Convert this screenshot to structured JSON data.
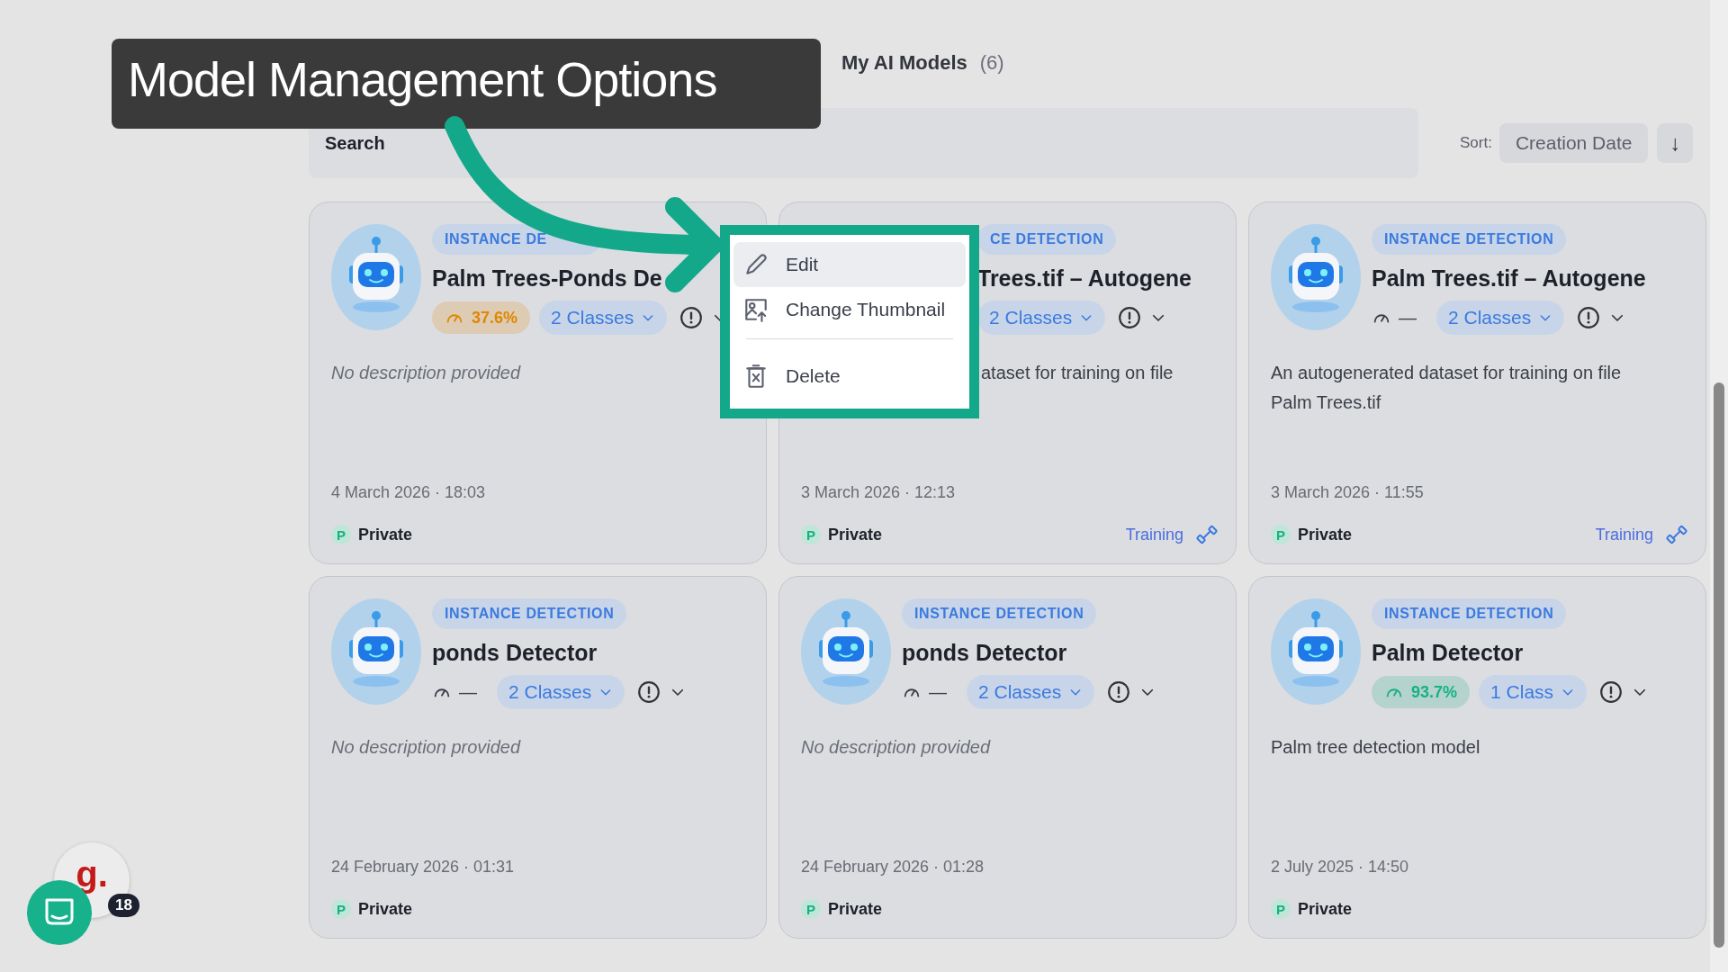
{
  "callout": {
    "text": "Model Management Options"
  },
  "header": {
    "title": "My AI Models",
    "count": "(6)"
  },
  "search": {
    "placeholder": "Search"
  },
  "sort": {
    "label": "Sort:",
    "value": "Creation Date",
    "arrow": "↓"
  },
  "cards": [
    {
      "kind": "full",
      "tag": "INSTANCE DE",
      "title": "Palm Trees-Ponds De",
      "score": {
        "text": "37.6%",
        "color": "#e08700"
      },
      "classes": "2 Classes",
      "description": {
        "text": "No description provided",
        "empty": true
      },
      "date": "4 March 2026 · 18:03",
      "visibility": {
        "initial": "P",
        "label": "Private"
      }
    },
    {
      "kind": "covered",
      "tag": "CE DETECTION",
      "title": "Trees.tif – Autogene",
      "classes": "2 Classes",
      "description": {
        "text": "ataset for training on file",
        "empty": false
      },
      "date": "3 March 2026 · 12:13",
      "visibility": {
        "initial": "P",
        "label": "Private"
      },
      "status": "Training"
    },
    {
      "kind": "full",
      "tag": "INSTANCE DETECTION",
      "title": "Palm Trees.tif – Autogene",
      "score": {
        "text": "—"
      },
      "classes": "2 Classes",
      "description": {
        "text": "An autogenerated dataset for training on file Palm Trees.tif",
        "empty": false
      },
      "date": "3 March 2026 · 11:55",
      "visibility": {
        "initial": "P",
        "label": "Private"
      },
      "status": "Training"
    },
    {
      "kind": "full",
      "tag": "INSTANCE DETECTION",
      "title": "ponds Detector",
      "score": {
        "text": "—"
      },
      "classes": "2 Classes",
      "description": {
        "text": "No description provided",
        "empty": true
      },
      "date": "24 February 2026 · 01:31",
      "visibility": {
        "initial": "P",
        "label": "Private"
      }
    },
    {
      "kind": "full",
      "tag": "INSTANCE DETECTION",
      "title": "ponds Detector",
      "score": {
        "text": "—"
      },
      "classes": "2 Classes",
      "description": {
        "text": "No description provided",
        "empty": true
      },
      "date": "24 February 2026 · 01:28",
      "visibility": {
        "initial": "P",
        "label": "Private"
      }
    },
    {
      "kind": "full",
      "tag": "INSTANCE DETECTION",
      "title": "Palm Detector",
      "score": {
        "text": "93.7%",
        "color": "#16b184"
      },
      "classes": "1 Class",
      "description": {
        "text": "Palm tree detection model",
        "empty": false
      },
      "date": "2 July 2025 · 14:50",
      "visibility": {
        "initial": "P",
        "label": "Private"
      }
    }
  ],
  "menu": {
    "items": [
      {
        "kind": "edit",
        "label": "Edit",
        "selected": true,
        "divider_before": false
      },
      {
        "kind": "thumbnail",
        "label": "Change Thumbnail",
        "selected": false,
        "divider_before": false
      },
      {
        "kind": "delete",
        "label": "Delete",
        "selected": false,
        "divider_before": true
      }
    ]
  },
  "widgets": {
    "avatar_letter": "g.",
    "badge": "18"
  }
}
